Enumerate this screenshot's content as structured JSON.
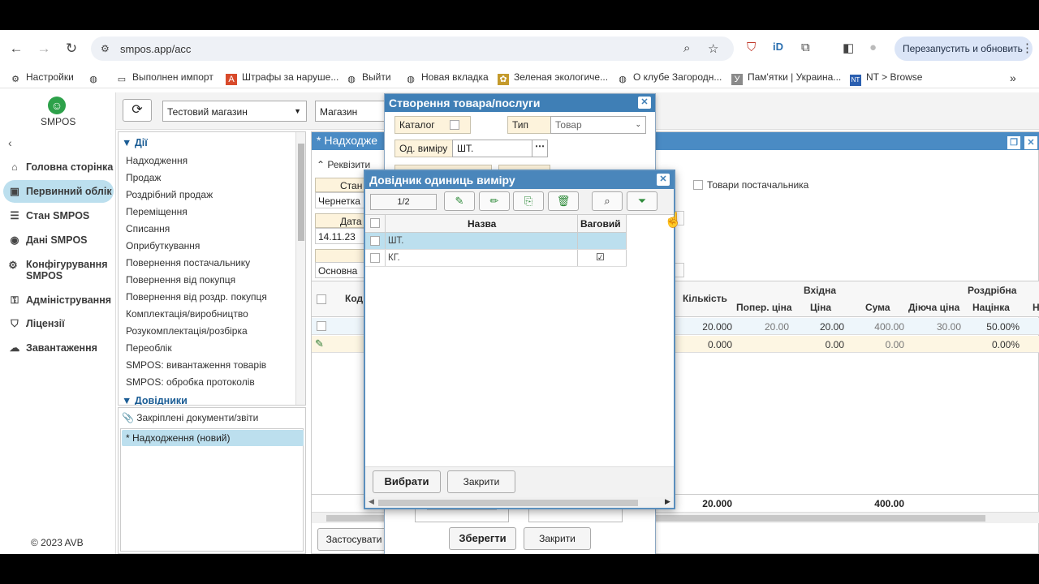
{
  "browser": {
    "url": "smpos.app/acc",
    "restart_label": "Перезапустить и обновить",
    "bookmarks": [
      {
        "label": "Настройки",
        "icon": "gear-icon"
      },
      {
        "label": "",
        "icon": "globe-icon"
      },
      {
        "label": "Выполнен импорт",
        "icon": "folder-icon"
      },
      {
        "label": "Штрафы за наруше...",
        "icon": "a-logo-icon"
      },
      {
        "label": "Выйти",
        "icon": "globe-icon"
      },
      {
        "label": "Новая вкладка",
        "icon": "globe-icon"
      },
      {
        "label": "Зеленая экологиче...",
        "icon": "leaf-icon"
      },
      {
        "label": "О клубе Загородн...",
        "icon": "globe-icon"
      },
      {
        "label": "Пам'ятки | Украина...",
        "icon": "y-logo-icon"
      },
      {
        "label": "NT > Browse",
        "icon": "nt-logo-icon"
      }
    ]
  },
  "app": {
    "logo_text": "SMPOS",
    "nav": [
      {
        "label": "Головна сторінка",
        "icon": "home-icon"
      },
      {
        "label": "Первинний облік",
        "icon": "briefcase-icon",
        "active": true
      },
      {
        "label": "Стан SMPOS",
        "icon": "list-icon"
      },
      {
        "label": "Дані SMPOS",
        "icon": "palette-icon"
      },
      {
        "label": "Конфігурування SMPOS",
        "icon": "cogs-icon"
      },
      {
        "label": "Адміністрування",
        "icon": "key-icon"
      },
      {
        "label": "Ліцензії",
        "icon": "tags-icon"
      },
      {
        "label": "Завантаження",
        "icon": "cloud-download-icon"
      }
    ],
    "copyright": "© 2023 AVB",
    "store_select": "Тестовий магазин",
    "store_label": "Магазин",
    "actions_header": "Дії",
    "actions": [
      "Надходження",
      "Продаж",
      "Роздрібний продаж",
      "Переміщення",
      "Списання",
      "Оприбуткування",
      "Повернення постачальнику",
      "Повернення від покупця",
      "Повернення від роздр. покупця",
      "Комплектація/виробництво",
      "Розукомплектація/розбірка",
      "Переоблік",
      "SMPOS: вивантаження товарів",
      "SMPOS: обробка протоколів"
    ],
    "directories_header": "Довідники",
    "attached_header": "Закріплені документи/звіти",
    "attached_item": "* Надходження (новий)"
  },
  "doc": {
    "title": "* Надходже",
    "requisites": "Реквізити",
    "state_label": "Стан",
    "state_value": "Чернетка",
    "date_label": "Дата",
    "date_value": "14.11.23",
    "main_value": "Основна",
    "supplier_goods": "Товари постачальника",
    "col_code": "Код",
    "col_qty": "Кількість",
    "group_in": "Вхідна",
    "group_retail": "Роздрібна",
    "col_prev_price": "Попер. ціна",
    "col_price": "Ціна",
    "col_sum": "Сума",
    "col_current_price": "Діюча ціна",
    "col_markup": "Націнка",
    "col_extra": "Но",
    "rows": [
      {
        "qty": "20.000",
        "prev_price": "20.00",
        "price": "20.00",
        "sum": "400.00",
        "current": "30.00",
        "markup": "50.00%"
      },
      {
        "qty": "0.000",
        "prev_price": "",
        "price": "0.00",
        "sum": "0.00",
        "current": "",
        "markup": "0.00%"
      }
    ],
    "total_qty": "20.000",
    "total_sum": "400.00",
    "apply": "Застосувати"
  },
  "create_dialog": {
    "title": "Створення товара/послуги",
    "catalog_label": "Каталог",
    "type_label": "Тип",
    "type_value": "Товар",
    "unit_label": "Од. виміру",
    "unit_value": "ШТ.",
    "save": "Зберегти",
    "close": "Закрити"
  },
  "units_dialog": {
    "title": "Довідник одиниць виміру",
    "page": "1/2",
    "col_name": "Назва",
    "col_weighted": "Ваговий",
    "rows": [
      {
        "name": "ШТ.",
        "weighted": false,
        "selected": true
      },
      {
        "name": "КГ.",
        "weighted": true,
        "selected": false
      }
    ],
    "choose": "Вибрати",
    "close": "Закрити"
  }
}
